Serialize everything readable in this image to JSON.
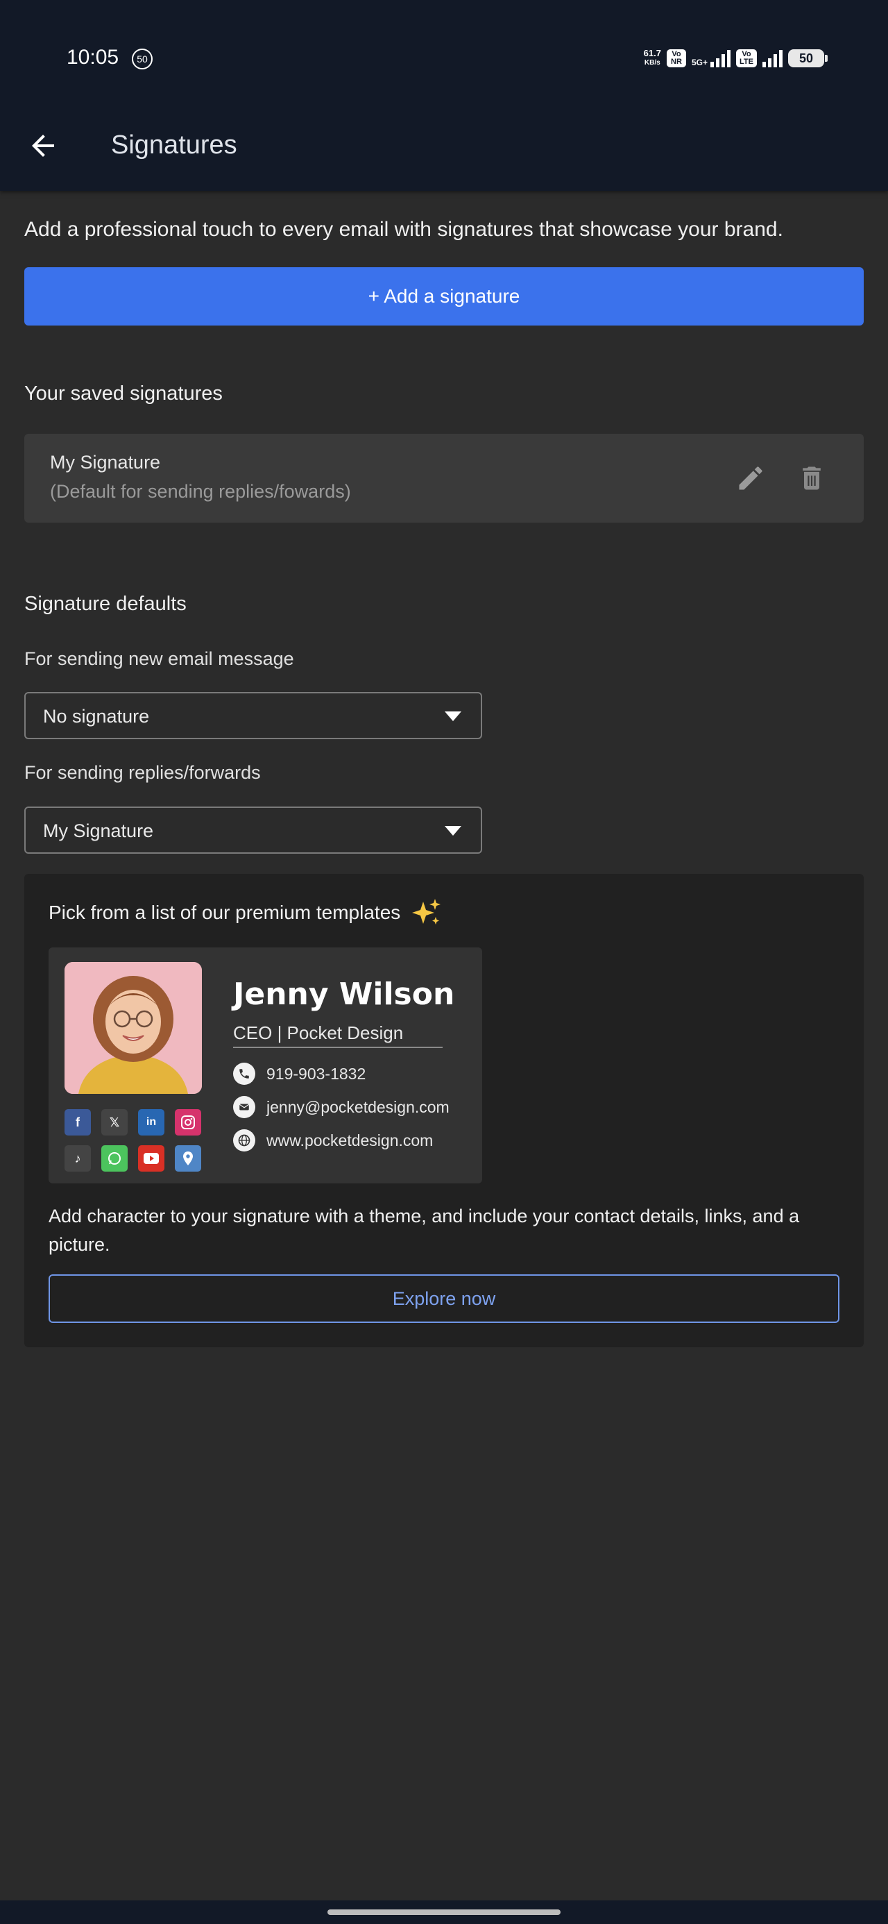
{
  "status_bar": {
    "time": "10:05",
    "notif_badge": "50",
    "net_speed": "61.7",
    "net_unit": "KB/s",
    "chip_vonr": "Vo NR",
    "chip_5g": "5G+",
    "chip_volte": "Vo LTE",
    "battery": "50"
  },
  "header": {
    "title": "Signatures"
  },
  "intro_text": "Add a professional touch to every email with signatures that showcase your brand.",
  "add_button_label": "+ Add a signature",
  "saved": {
    "heading": "Your saved signatures",
    "items": [
      {
        "name": "My Signature",
        "subtitle": "(Default for sending replies/fowards)"
      }
    ]
  },
  "defaults": {
    "heading": "Signature defaults",
    "new_label": "For sending new email message",
    "new_value": "No signature",
    "reply_label": "For sending replies/forwards",
    "reply_value": "My Signature"
  },
  "promo": {
    "title": "Pick from a list of our premium templates",
    "template": {
      "name": "Jenny Wilson",
      "role": "CEO | Pocket Design",
      "phone": "919-903-1832",
      "email": "jenny@pocketdesign.com",
      "website": "www.pocketdesign.com",
      "socials": [
        "facebook-icon",
        "x-icon",
        "linkedin-icon",
        "instagram-icon",
        "tiktok-icon",
        "whatsapp-icon",
        "youtube-icon",
        "location-icon"
      ]
    },
    "description": "Add character to your signature with a theme, and include your contact details, links, and a picture.",
    "button_label": "Explore now"
  },
  "colors": {
    "primary": "#3b72ec",
    "background": "#2b2b2b",
    "topbar": "#121927",
    "outline_accent": "#7ea2ef"
  }
}
